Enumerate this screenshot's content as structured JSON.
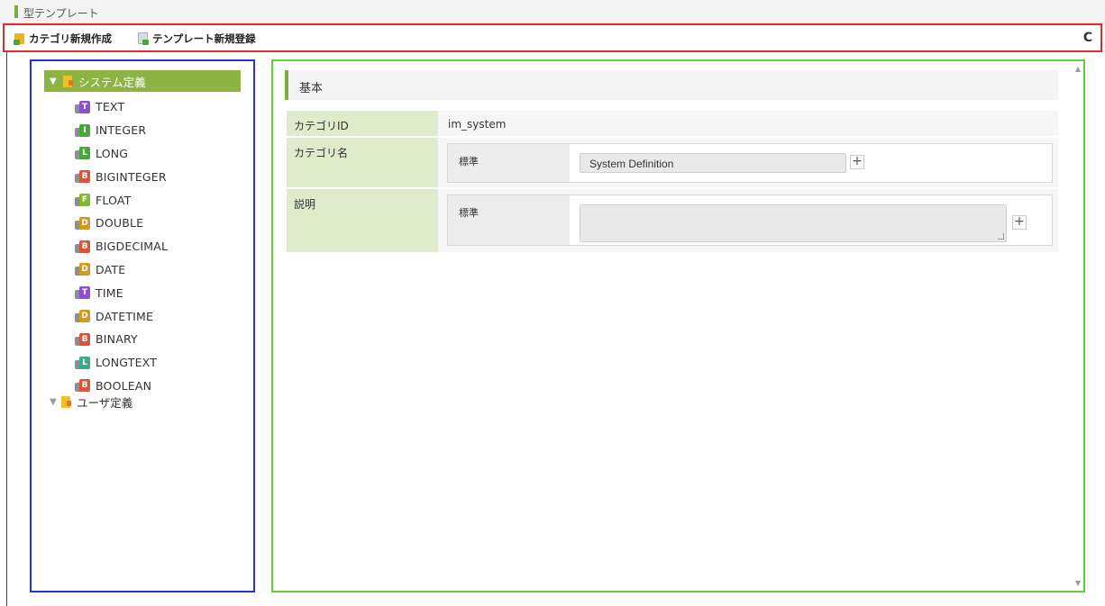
{
  "window": {
    "title": "型テンプレート"
  },
  "toolbar": {
    "new_category": "カテゴリ新規作成",
    "new_template": "テンプレート新規登録",
    "refresh_glyph": "C"
  },
  "tree": {
    "system": "システム定義",
    "user": "ユーザ定義",
    "items": [
      {
        "label": "TEXT",
        "badge": "T",
        "color": "#8e4fc8"
      },
      {
        "label": "INTEGER",
        "badge": "I",
        "color": "#4aa53c"
      },
      {
        "label": "LONG",
        "badge": "L",
        "color": "#4aa53c"
      },
      {
        "label": "BIGINTEGER",
        "badge": "B",
        "color": "#d9553a"
      },
      {
        "label": "FLOAT",
        "badge": "F",
        "color": "#86b82d"
      },
      {
        "label": "DOUBLE",
        "badge": "D",
        "color": "#d49a1f"
      },
      {
        "label": "BIGDECIMAL",
        "badge": "B",
        "color": "#d9553a"
      },
      {
        "label": "DATE",
        "badge": "D",
        "color": "#d49a1f"
      },
      {
        "label": "TIME",
        "badge": "T",
        "color": "#8e4fc8"
      },
      {
        "label": "DATETIME",
        "badge": "D",
        "color": "#d49a1f"
      },
      {
        "label": "BINARY",
        "badge": "B",
        "color": "#d9553a"
      },
      {
        "label": "LONGTEXT",
        "badge": "L",
        "color": "#3aab8a"
      },
      {
        "label": "BOOLEAN",
        "badge": "B",
        "color": "#d9553a"
      }
    ]
  },
  "detail": {
    "section_title": "基本",
    "category_id_label": "カテゴリID",
    "category_id_value": "im_system",
    "category_name_label": "カテゴリ名",
    "standard_label": "標準",
    "category_name_value": "System Definition",
    "description_label": "説明",
    "description_standard_label": "標準",
    "description_value": "",
    "plus": "+"
  }
}
